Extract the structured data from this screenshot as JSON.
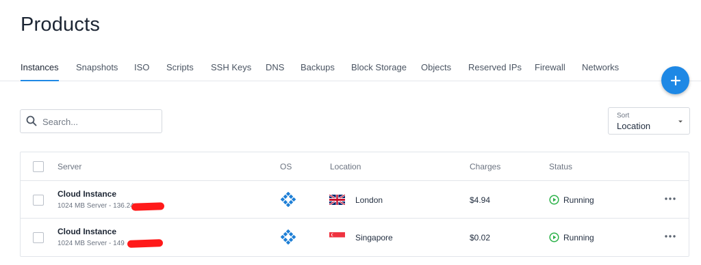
{
  "page": {
    "title": "Products"
  },
  "tabs": [
    {
      "label": "Instances",
      "active": true
    },
    {
      "label": "Snapshots"
    },
    {
      "label": "ISO"
    },
    {
      "label": "Scripts"
    },
    {
      "label": "SSH Keys"
    },
    {
      "label": "DNS"
    },
    {
      "label": "Backups"
    },
    {
      "label": "Block Storage"
    },
    {
      "label": "Objects"
    },
    {
      "label": "Reserved IPs"
    },
    {
      "label": "Firewall"
    },
    {
      "label": "Networks"
    }
  ],
  "fab": {
    "icon": "plus-icon",
    "color": "#1e88e5"
  },
  "search": {
    "placeholder": "Search...",
    "value": "",
    "icon": "search-icon"
  },
  "sort": {
    "label": "Sort",
    "value": "Location"
  },
  "table": {
    "headers": {
      "server": "Server",
      "os": "OS",
      "location": "Location",
      "charges": "Charges",
      "status": "Status"
    },
    "rows": [
      {
        "name": "Cloud Instance",
        "sub": "1024 MB Server - 136.24",
        "os_icon": "os-logo-icon",
        "flag": "uk-flag-icon",
        "location": "London",
        "charges": "$4.94",
        "status": "Running",
        "status_color": "#2db24a"
      },
      {
        "name": "Cloud Instance",
        "sub": "1024 MB Server - 149",
        "os_icon": "os-logo-icon",
        "flag": "singapore-flag-icon",
        "location": "Singapore",
        "charges": "$0.02",
        "status": "Running",
        "status_color": "#2db24a"
      }
    ]
  }
}
